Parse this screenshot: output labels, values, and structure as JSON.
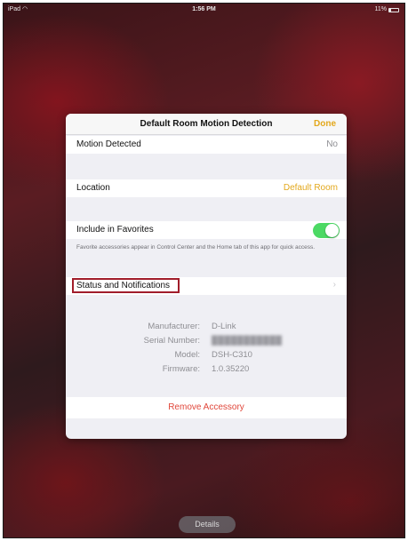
{
  "status_bar": {
    "device": "iPad",
    "wifi_icon": "wifi-icon",
    "time": "1:56 PM",
    "battery": "11%"
  },
  "modal": {
    "title": "Default Room Motion Detection",
    "done_label": "Done",
    "motion": {
      "label": "Motion Detected",
      "value": "No"
    },
    "location": {
      "label": "Location",
      "value": "Default Room"
    },
    "favorites": {
      "label": "Include in Favorites",
      "enabled": true,
      "footnote": "Favorite accessories appear in Control Center and the Home tab of this app for quick access."
    },
    "status_notifications": {
      "label": "Status and Notifications"
    },
    "info": {
      "manufacturer_label": "Manufacturer:",
      "manufacturer_value": "D-Link",
      "serial_label": "Serial Number:",
      "model_label": "Model:",
      "model_value": "DSH-C310",
      "firmware_label": "Firmware:",
      "firmware_value": "1.0.35220"
    },
    "remove_label": "Remove Accessory"
  },
  "details_label": "Details",
  "colors": {
    "accent": "#e3a81c",
    "toggle_on": "#4cd964",
    "destructive": "#e0463a",
    "highlight_box": "#a11d2a"
  }
}
